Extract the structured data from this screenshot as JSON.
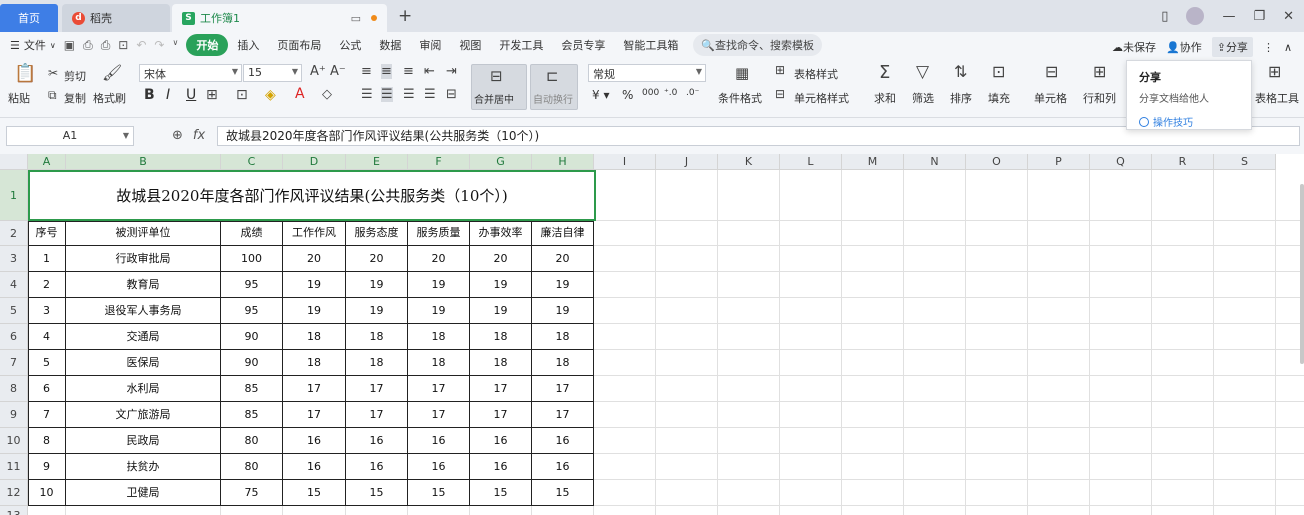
{
  "tabs": {
    "home": "首页",
    "daoke": "稻壳",
    "workbook": "工作簿1"
  },
  "menu": {
    "file": "文件",
    "items": [
      "开始",
      "插入",
      "页面布局",
      "公式",
      "数据",
      "审阅",
      "视图",
      "开发工具",
      "会员专享",
      "智能工具箱"
    ],
    "search": "查找命令、搜索模板",
    "unsaved": "未保存",
    "collab": "协作",
    "share": "分享"
  },
  "ribbon": {
    "paste": "粘贴",
    "cut": "剪切",
    "copy": "复制",
    "format_painter": "格式刷",
    "font_name": "宋体",
    "font_size": "15",
    "merge_center": "合并居中",
    "auto_wrap": "自动换行",
    "number_format": "常规",
    "conditional_format": "条件格式",
    "table_style": "表格样式",
    "cell_style": "单元格样式",
    "sum": "求和",
    "filter": "筛选",
    "sort": "排序",
    "fill": "填充",
    "cell": "单元格",
    "row_col": "行和列",
    "table_tools": "表格工具",
    "bold": "B",
    "italic": "I",
    "underline": "U"
  },
  "share_popup": {
    "title": "分享",
    "desc": "分享文档给他人",
    "link": "操作技巧"
  },
  "formula_bar": {
    "cell_ref": "A1",
    "content": "故城县2020年度各部门作风评议结果(公共服务类（10个）)"
  },
  "columns": [
    "A",
    "B",
    "C",
    "D",
    "E",
    "F",
    "G",
    "H",
    "I",
    "J",
    "K",
    "L",
    "M",
    "N",
    "O",
    "P",
    "Q",
    "R",
    "S"
  ],
  "rows": [
    "1",
    "2",
    "3",
    "4",
    "5",
    "6",
    "7",
    "8",
    "9",
    "10",
    "11",
    "12",
    "13"
  ],
  "sheet": {
    "title": "故城县2020年度各部门作风评议结果(公共服务类（10个）)",
    "headers": [
      "序号",
      "被测评单位",
      "成绩",
      "工作作风",
      "服务态度",
      "服务质量",
      "办事效率",
      "廉洁自律"
    ],
    "data": [
      [
        "1",
        "行政审批局",
        "100",
        "20",
        "20",
        "20",
        "20",
        "20"
      ],
      [
        "2",
        "教育局",
        "95",
        "19",
        "19",
        "19",
        "19",
        "19"
      ],
      [
        "3",
        "退役军人事务局",
        "95",
        "19",
        "19",
        "19",
        "19",
        "19"
      ],
      [
        "4",
        "交通局",
        "90",
        "18",
        "18",
        "18",
        "18",
        "18"
      ],
      [
        "5",
        "医保局",
        "90",
        "18",
        "18",
        "18",
        "18",
        "18"
      ],
      [
        "6",
        "水利局",
        "85",
        "17",
        "17",
        "17",
        "17",
        "17"
      ],
      [
        "7",
        "文广旅游局",
        "85",
        "17",
        "17",
        "17",
        "17",
        "17"
      ],
      [
        "8",
        "民政局",
        "80",
        "16",
        "16",
        "16",
        "16",
        "16"
      ],
      [
        "9",
        "扶贫办",
        "80",
        "16",
        "16",
        "16",
        "16",
        "16"
      ],
      [
        "10",
        "卫健局",
        "75",
        "15",
        "15",
        "15",
        "15",
        "15"
      ]
    ]
  }
}
